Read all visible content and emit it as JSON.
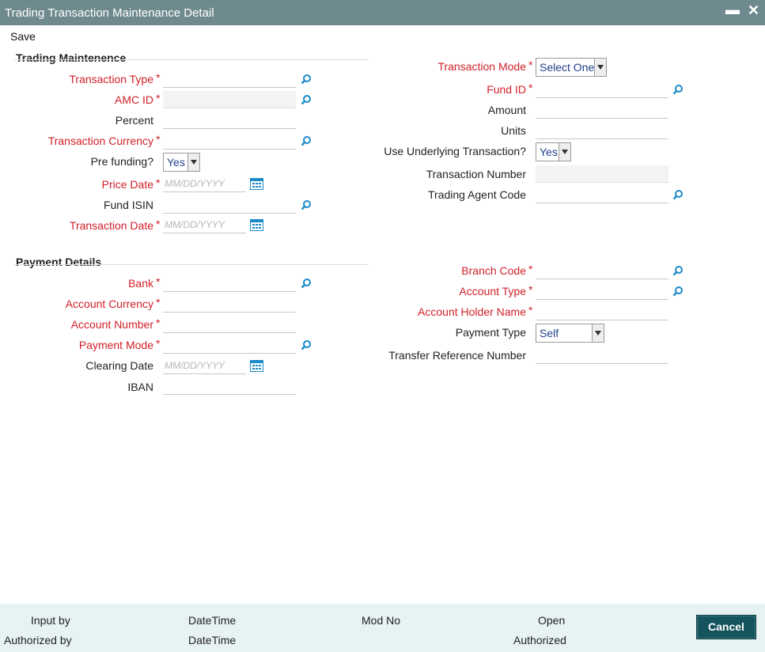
{
  "window": {
    "title": "Trading Transaction Maintenance Detail",
    "minimize": "▬",
    "close": "✕"
  },
  "toolbar": {
    "save_label": "Save"
  },
  "trading": {
    "section_title": "Trading Maintenence",
    "transaction_type": "Transaction Type",
    "amc_id": "AMC ID",
    "percent": "Percent",
    "transaction_currency": "Transaction Currency",
    "pre_funding": "Pre funding?",
    "pre_funding_value": "Yes",
    "price_date": "Price Date",
    "fund_isin": "Fund ISIN",
    "transaction_date": "Transaction Date",
    "date_placeholder": "MM/DD/YYYY",
    "transaction_mode": "Transaction Mode",
    "transaction_mode_value": "Select One",
    "fund_id": "Fund ID",
    "amount": "Amount",
    "units": "Units",
    "use_underlying": "Use Underlying Transaction?",
    "use_underlying_value": "Yes",
    "transaction_number": "Transaction Number",
    "trading_agent_code": "Trading Agent Code"
  },
  "payment": {
    "section_title": "Payment Details",
    "bank": "Bank",
    "account_currency": "Account Currency",
    "account_number": "Account Number",
    "payment_mode": "Payment Mode",
    "clearing_date": "Clearing Date",
    "date_placeholder": "MM/DD/YYYY",
    "iban": "IBAN",
    "branch_code": "Branch Code",
    "account_type": "Account Type",
    "account_holder_name": "Account Holder Name",
    "payment_type": "Payment Type",
    "payment_type_value": "Self",
    "transfer_reference_number": "Transfer Reference Number"
  },
  "required_marker": "*",
  "footer": {
    "input_by": "Input by",
    "datetime1": "DateTime",
    "mod_no": "Mod No",
    "open": "Open",
    "authorized_by": "Authorized by",
    "datetime2": "DateTime",
    "authorized": "Authorized",
    "cancel_label": "Cancel"
  },
  "colors": {
    "titlebar": "#6f8a8f",
    "required": "#d1202a",
    "icon": "#1b8ac8",
    "cancel": "#15545c",
    "footer": "#e7f2f2"
  },
  "icons": {
    "search": "search-icon",
    "calendar": "calendar-icon"
  }
}
